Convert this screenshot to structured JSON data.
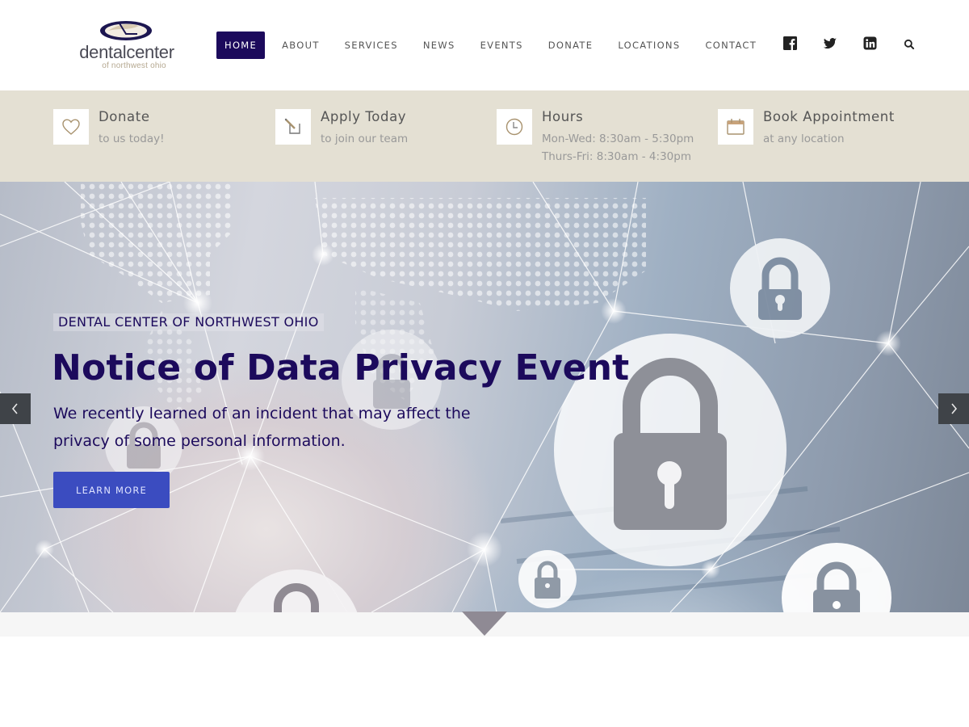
{
  "brand": {
    "logo_text": "dentalcenter",
    "logo_subtext": "of northwest ohio"
  },
  "nav": {
    "items": [
      {
        "label": "HOME",
        "active": true
      },
      {
        "label": "ABOUT",
        "active": false
      },
      {
        "label": "SERVICES",
        "active": false
      },
      {
        "label": "NEWS",
        "active": false
      },
      {
        "label": "EVENTS",
        "active": false
      },
      {
        "label": "DONATE",
        "active": false
      },
      {
        "label": "LOCATIONS",
        "active": false
      },
      {
        "label": "CONTACT",
        "active": false
      }
    ],
    "social_icons": [
      "facebook-icon",
      "twitter-icon",
      "linkedin-icon"
    ],
    "search_icon": "search-icon",
    "active_color": "#1c0a5c"
  },
  "infobar": {
    "items": [
      {
        "icon": "heart-icon",
        "title": "Donate",
        "lines": [
          "to us today!"
        ]
      },
      {
        "icon": "edit-icon",
        "title": "Apply Today",
        "lines": [
          "to join our team"
        ]
      },
      {
        "icon": "clock-icon",
        "title": "Hours",
        "lines": [
          "Mon-Wed: 8:30am - 5:30pm",
          "Thurs-Fri: 8:30am - 4:30pm"
        ]
      },
      {
        "icon": "calendar-icon",
        "title": "Book Appointment",
        "lines": [
          "at any location"
        ]
      }
    ],
    "background": "#e4e0d3",
    "icon_color": "#a8926e"
  },
  "hero": {
    "overline": "DENTAL CENTER OF NORTHWEST OHIO",
    "title": "Notice of Data Privacy Event",
    "description": "We recently learned of an incident that may affect the privacy of some personal information.",
    "button_label": "LEARN MORE",
    "prev_icon": "chevron-left-icon",
    "next_icon": "chevron-right-icon",
    "text_color": "#1c0a5c",
    "button_color": "#3b4cc0"
  }
}
